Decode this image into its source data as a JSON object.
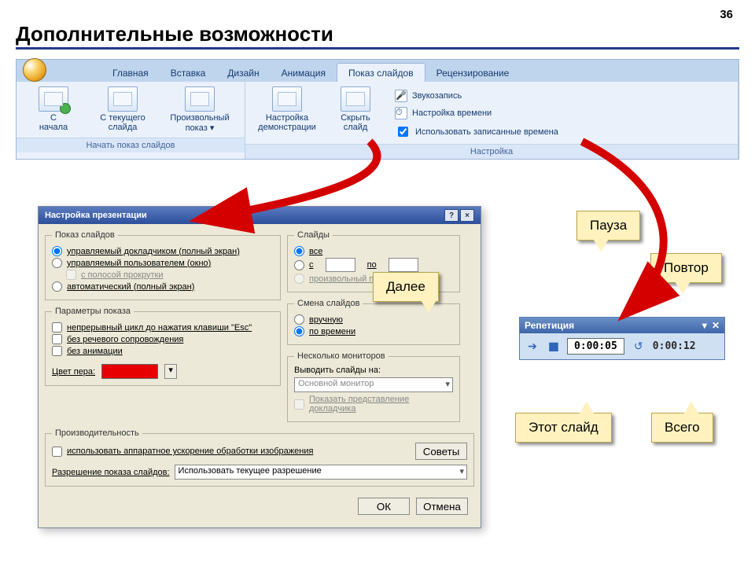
{
  "page": {
    "number": "36",
    "title": "Дополнительные возможности"
  },
  "ribbon": {
    "tabs": [
      "Главная",
      "Вставка",
      "Дизайн",
      "Анимация",
      "Показ слайдов",
      "Рецензирование"
    ],
    "active": 4,
    "group1": {
      "title": "Начать показ слайдов",
      "btns": [
        "С\nначала",
        "С текущего\nслайда",
        "Произвольный\nпоказ ▾"
      ]
    },
    "group2": {
      "title": "Настройка",
      "btns": [
        "Настройка\nдемонстрации",
        "Скрыть\nслайд"
      ],
      "opts": [
        "Звукозапись",
        "Настройка времени",
        "Использовать записанные времена"
      ]
    }
  },
  "dlg": {
    "title": "Настройка презентации",
    "slides_legend": "Показ слайдов",
    "s1": "управляемый докладчиком (полный экран)",
    "s2": "управляемый пользователем (окно)",
    "s2a": "с полосой прокрутки",
    "s3": "автоматический (полный экран)",
    "params_legend": "Параметры показа",
    "p1": "непрерывный цикл до нажатия клавиши \"Esc\"",
    "p2": "без речевого сопровождения",
    "p3": "без анимации",
    "pen": "Цвет пера:",
    "slides2": "Слайды",
    "sl_all": "все",
    "sl_from": "с",
    "sl_to": "по",
    "sl_custom": "произвольный показ:",
    "change": "Смена слайдов",
    "ch1": "вручную",
    "ch2": "по времени",
    "mon": "Несколько мониторов",
    "mon_lab": "Выводить слайды на:",
    "mon_val": "Основной монитор",
    "mon_chk": "Показать представление докладчика",
    "perf": "Производительность",
    "perf_chk": "использовать аппаратное ускорение обработки изображения",
    "tips": "Советы",
    "res_lab": "Разрешение показа слайдов:",
    "res_val": "Использовать текущее разрешение",
    "ok": "ОК",
    "cancel": "Отмена"
  },
  "reh": {
    "title": "Репетиция",
    "cur": "0:00:05",
    "total": "0:00:12"
  },
  "callouts": {
    "next": "Далее",
    "pause": "Пауза",
    "repeat": "Повтор",
    "this": "Этот слайд",
    "total": "Всего"
  }
}
